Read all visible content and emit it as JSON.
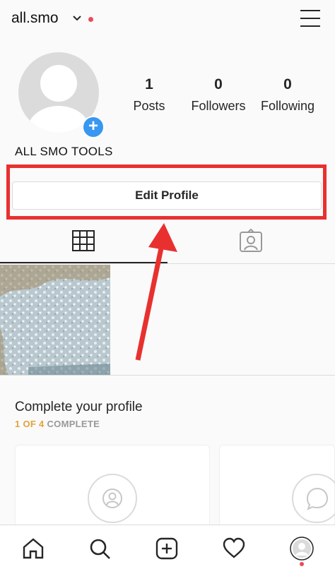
{
  "header": {
    "username": "all.smo",
    "has_notification_dot": true
  },
  "profile": {
    "display_name": "ALL SMO TOOLS",
    "stats": [
      {
        "value": "1",
        "label": "Posts"
      },
      {
        "value": "0",
        "label": "Followers"
      },
      {
        "value": "0",
        "label": "Following"
      }
    ],
    "edit_button_label": "Edit Profile"
  },
  "tabs": [
    {
      "icon": "grid-icon",
      "active": true
    },
    {
      "icon": "tagged-icon",
      "active": false
    }
  ],
  "complete_profile": {
    "title": "Complete your profile",
    "progress_count": "1 OF 4",
    "progress_word": "COMPLETE"
  },
  "nav": [
    "home-icon",
    "search-icon",
    "new-post-icon",
    "heart-icon",
    "profile-avatar-icon"
  ],
  "colors": {
    "highlight": "#e8312f",
    "accent_blue": "#3897f0",
    "notification": "#ed4956",
    "progress": "#e2a33a"
  }
}
